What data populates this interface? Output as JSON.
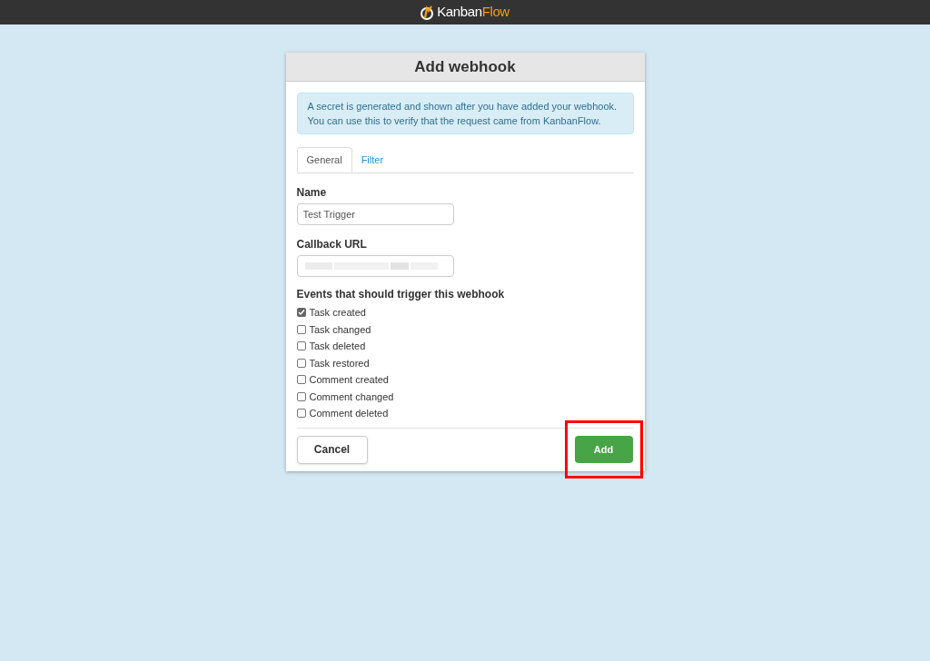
{
  "header": {
    "logo": {
      "first": "Kanban",
      "second": "Flow"
    }
  },
  "dialog": {
    "title": "Add webhook",
    "info": "A secret is generated and shown after you have added your webhook. You can use this to verify that the request came from KanbanFlow.",
    "tabs": [
      {
        "label": "General",
        "selected": true
      },
      {
        "label": "Filter",
        "selected": false
      }
    ],
    "fields": [
      {
        "label": "Name",
        "value": "Test Trigger",
        "redacted": false
      },
      {
        "label": "Callback URL",
        "redacted": true
      }
    ],
    "events_label": "Events that should trigger this webhook",
    "events": [
      {
        "label": "Task created",
        "checked": true
      },
      {
        "label": "Task changed",
        "checked": false
      },
      {
        "label": "Task deleted",
        "checked": false
      },
      {
        "label": "Task restored",
        "checked": false
      },
      {
        "label": "Comment created",
        "checked": false
      },
      {
        "label": "Comment changed",
        "checked": false
      },
      {
        "label": "Comment deleted",
        "checked": false
      }
    ],
    "buttons": [
      {
        "label": "Cancel",
        "kind": "secondary",
        "highlighted": false
      },
      {
        "label": "Add",
        "kind": "primary",
        "highlighted": true
      }
    ]
  }
}
